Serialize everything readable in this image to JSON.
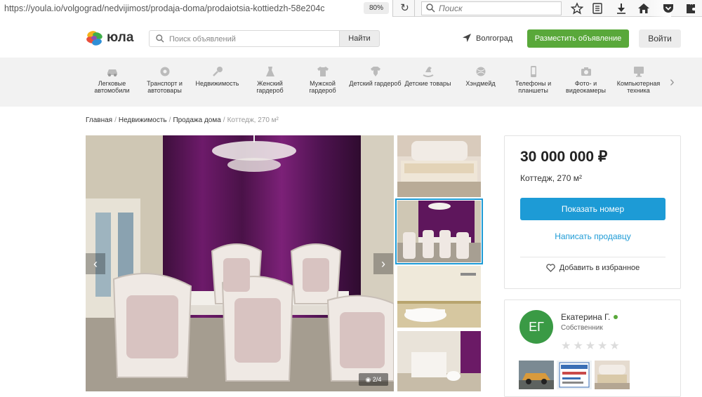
{
  "browser": {
    "url": "https://youla.io/volgograd/nedvijimost/prodaja-doma/prodaiotsia-kottiedzh-58e204c",
    "zoom": "80%",
    "search_placeholder": "Поиск"
  },
  "header": {
    "logo": "юла",
    "search_placeholder": "Поиск объявлений",
    "search_button": "Найти",
    "city": "Волгоград",
    "post_button": "Разместить объявление",
    "login_button": "Войти"
  },
  "categories": [
    {
      "label": "Легковые автомобили",
      "icon": "car-icon"
    },
    {
      "label": "Транспорт и автотовары",
      "icon": "wheel-icon"
    },
    {
      "label": "Недвижимость",
      "icon": "key-icon"
    },
    {
      "label": "Женский гардероб",
      "icon": "dress-icon"
    },
    {
      "label": "Мужской гардероб",
      "icon": "shirt-icon"
    },
    {
      "label": "Детский гардероб",
      "icon": "baby-clothes-icon"
    },
    {
      "label": "Детские товары",
      "icon": "rocking-horse-icon"
    },
    {
      "label": "Хэндмейд",
      "icon": "yarn-icon"
    },
    {
      "label": "Телефоны и планшеты",
      "icon": "phone-icon"
    },
    {
      "label": "Фото- и видеокамеры",
      "icon": "camera-icon"
    },
    {
      "label": "Компьютерная техника",
      "icon": "monitor-icon"
    }
  ],
  "breadcrumb": [
    "Главная",
    "Недвижимость",
    "Продажа дома",
    "Коттедж, 270 м²"
  ],
  "gallery": {
    "counter": "2/4",
    "current_index": 2,
    "total": 4
  },
  "listing": {
    "price": "30 000 000 ₽",
    "title": "Коттедж, 270 м²",
    "show_phone": "Показать номер",
    "write_seller": "Написать продавцу",
    "add_favorite": "Добавить в избранное"
  },
  "seller": {
    "initials": "ЕГ",
    "name": "Екатерина Г.",
    "role": "Собственник",
    "rating": 0,
    "max_rating": 5,
    "online": true
  },
  "colors": {
    "accent_blue": "#1d9bd6",
    "brand_green": "#59a83a",
    "avatar_green": "#3a9a45"
  }
}
